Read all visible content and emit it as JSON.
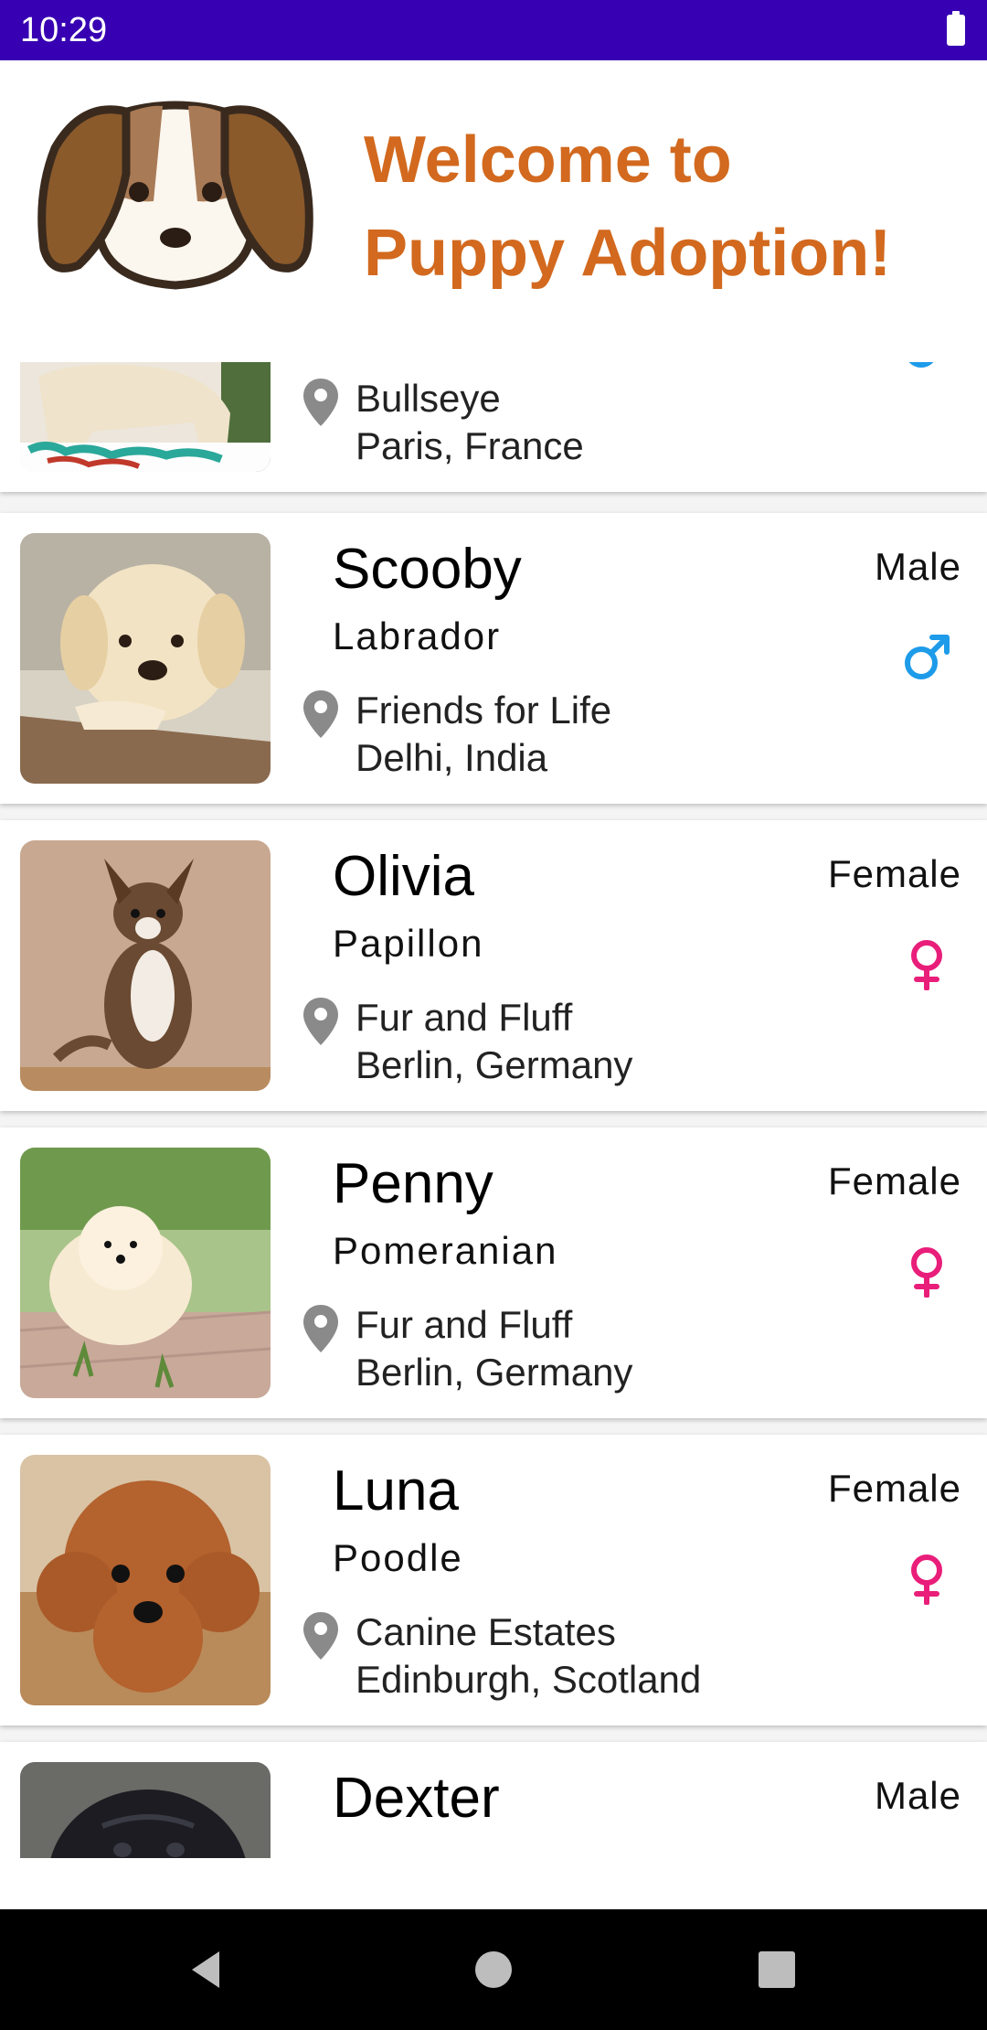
{
  "status_bar": {
    "time": "10:29"
  },
  "header": {
    "logo_icon": "puppy-face-icon",
    "title_line1": "Welcome to",
    "title_line2": "Puppy Adoption!",
    "title_color": "#d2691e"
  },
  "colors": {
    "status_bar": "#3700b3",
    "male": "#1e9be9",
    "female": "#e91e7a",
    "pin": "#8a8a8a"
  },
  "puppies": [
    {
      "name": "",
      "breed": "",
      "shelter": "Bullseye",
      "city": "Paris, France",
      "gender": "",
      "gender_icon": "male-icon"
    },
    {
      "name": "Scooby",
      "breed": "Labrador",
      "shelter": "Friends for Life",
      "city": "Delhi, India",
      "gender": "Male",
      "gender_icon": "male-icon"
    },
    {
      "name": "Olivia",
      "breed": "Papillon",
      "shelter": "Fur and Fluff",
      "city": "Berlin, Germany",
      "gender": "Female",
      "gender_icon": "female-icon"
    },
    {
      "name": "Penny",
      "breed": "Pomeranian",
      "shelter": "Fur and Fluff",
      "city": "Berlin, Germany",
      "gender": "Female",
      "gender_icon": "female-icon"
    },
    {
      "name": "Luna",
      "breed": "Poodle",
      "shelter": "Canine Estates",
      "city": "Edinburgh, Scotland",
      "gender": "Female",
      "gender_icon": "female-icon"
    },
    {
      "name": "Dexter",
      "breed": "",
      "shelter": "",
      "city": "",
      "gender": "Male",
      "gender_icon": "male-icon"
    }
  ],
  "nav": {
    "back": "back-triangle-icon",
    "home": "home-circle-icon",
    "recents": "recents-square-icon"
  }
}
